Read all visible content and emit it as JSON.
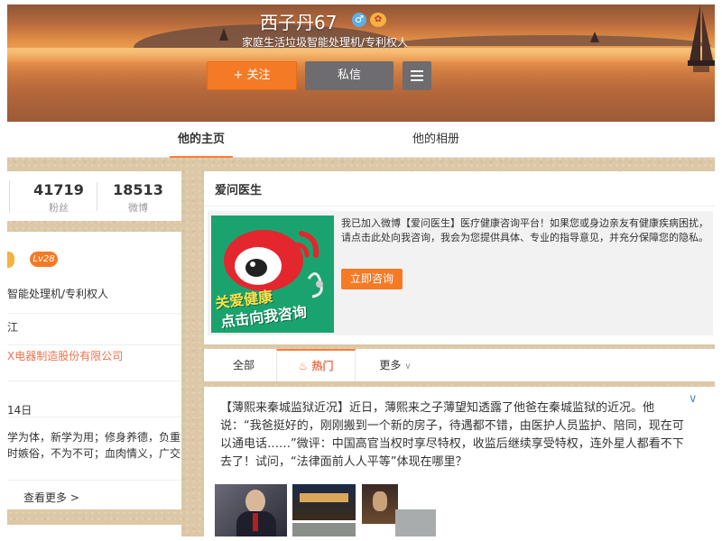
{
  "profile": {
    "name": "西子丹67",
    "gender_icon": "♂",
    "vip_icon": "✿",
    "intro": "家庭生活垃圾智能处理机/专利权人",
    "follow_label": "+ 关注",
    "message_label": "私信"
  },
  "tabs": [
    "他的主页",
    "他的相册"
  ],
  "stats": [
    {
      "num": "41719",
      "label": "粉丝"
    },
    {
      "num": "18513",
      "label": "微博"
    }
  ],
  "info": {
    "level": "Lv28",
    "occupation": "智能处理机/专利权人",
    "location": "江",
    "company": "X电器制造股份有限公司",
    "date": "14日",
    "motto_line1": "学为体，新学为用；修身养德，负重",
    "motto_line2": "时嫉俗，不为不可；血肉情义，广交",
    "more": "查看更多 >"
  },
  "doctor": {
    "title": "爱问医生",
    "text": "我已加入微博【爱问医生】医疗健康咨询平台！如果您或身边亲友有健康疾病困扰，请点击此处向我咨询，我会为您提供具体、专业的指导意见，并充分保障您的隐私。",
    "consult_label": "立即咨询",
    "ad_line1": "关爱健康",
    "ad_line2": "点击向我咨询"
  },
  "feed_tabs": {
    "all": "全部",
    "hot": "热门",
    "more": "更多"
  },
  "post": {
    "text": "【薄熙来秦城监狱近况】近日，薄熙来之子薄望知透露了他爸在秦城监狱的近况。他说：“我爸挺好的，刚刚搬到一个新的房子，待遇都不错，由医护人员监护、陪同，现在可以通电话……”微评：中国高官当权时享尽特权，收监后继续享受特权，连外星人都看不下去了！试问，“法律面前人人平等”体现在哪里？"
  },
  "colors": {
    "accent": "#f57a26",
    "link": "#eb7350",
    "dark_button": "#6e6c6e"
  }
}
